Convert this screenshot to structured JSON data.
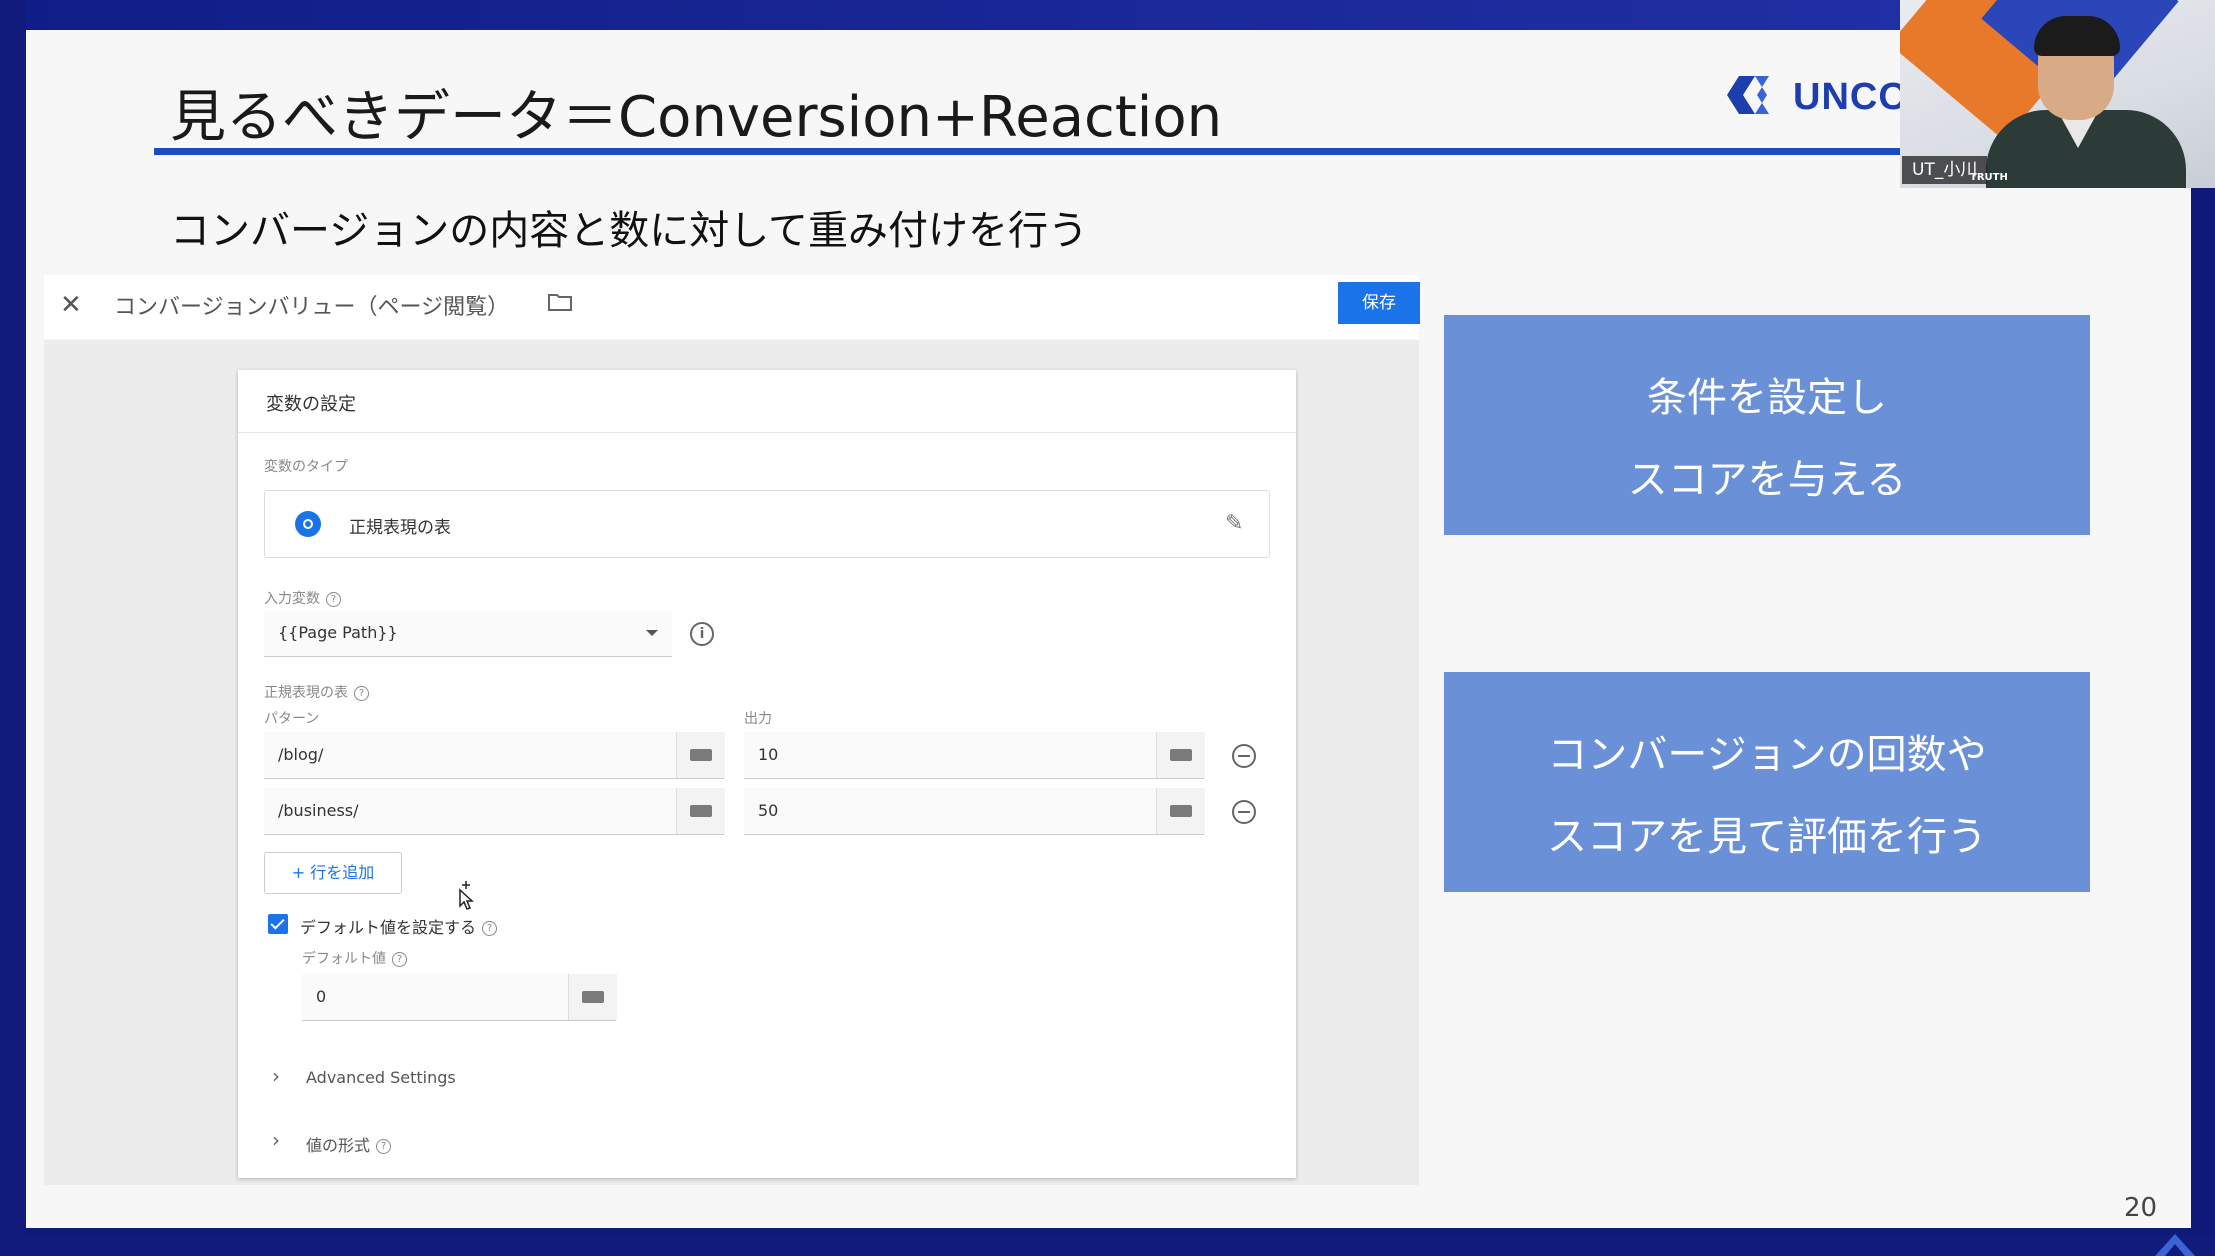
{
  "slide": {
    "title": "見るべきデータ＝Conversion+Reaction",
    "subtitle": "コンバージョンの内容と数に対して重み付けを行う",
    "logo_text": "UNCO",
    "page_number": "20",
    "accent_color": "#1b4cc0"
  },
  "webcam": {
    "participant_name": "UT_小川",
    "shirt_text": "TRUTH"
  },
  "editor": {
    "title": "コンバージョンバリュー（ページ閲覧）",
    "save_label": "保存",
    "card_title": "変数の設定",
    "variable_type_label": "変数のタイプ",
    "variable_type_value": "正規表現の表",
    "input_variable_label": "入力変数",
    "input_variable_value": "{{Page Path}}",
    "regex_table_label": "正規表現の表",
    "pattern_header": "パターン",
    "output_header": "出力",
    "rows": [
      {
        "pattern": "/blog/",
        "output": "10"
      },
      {
        "pattern": "/business/",
        "output": "50"
      }
    ],
    "add_row_label": "+ 行を追加",
    "default_checkbox_label": "デフォルト値を設定する",
    "default_value_label": "デフォルト値",
    "default_value": "0",
    "advanced_settings_label": "Advanced Settings",
    "value_format_label": "値の形式"
  },
  "callouts": [
    {
      "line1": "条件を設定し",
      "line2": "スコアを与える"
    },
    {
      "line1": "コンバージョンの回数や",
      "line2": "スコアを見て評価を行う"
    }
  ]
}
